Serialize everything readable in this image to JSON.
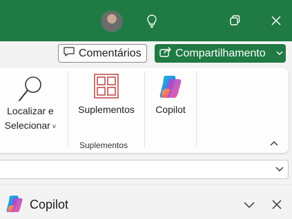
{
  "header": {
    "comments_label": "Comentários",
    "share_label": "Compartilhamento"
  },
  "ribbon": {
    "find_select_line1": "Localizar e",
    "find_select_line2": "Selecionar",
    "addins_label": "Suplementos",
    "addins_group_label": "Suplementos",
    "copilot_label": "Copilot"
  },
  "copilot_pane": {
    "title": "Copilot"
  },
  "colors": {
    "titlebar": "#1f7a43",
    "accent_green": "#1f7a43",
    "addins_icon": "#c0504d"
  }
}
